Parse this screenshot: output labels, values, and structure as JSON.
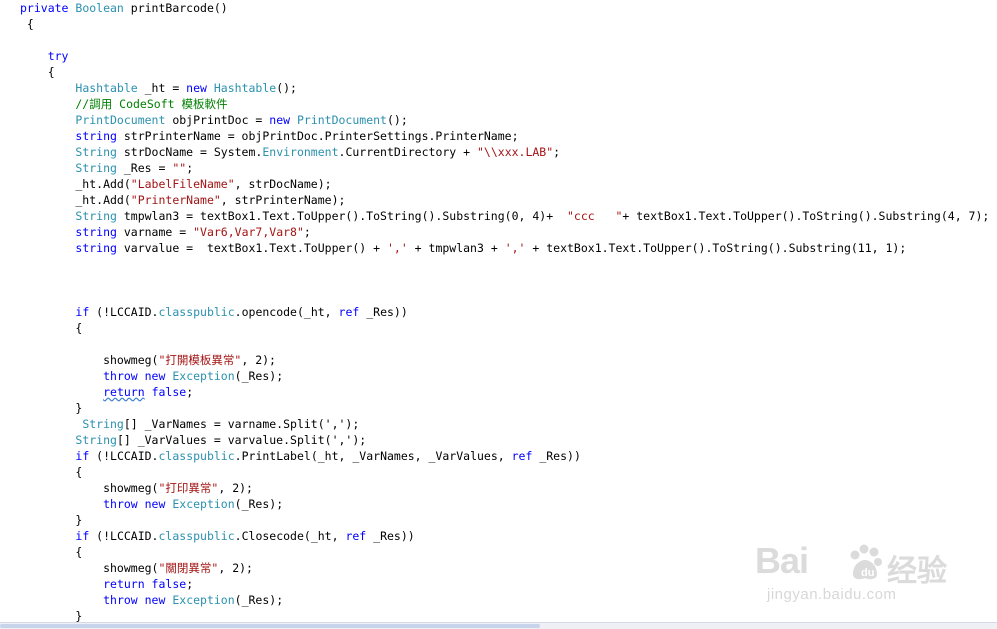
{
  "code": {
    "lines": [
      [
        {
          "t": "private ",
          "c": "kw"
        },
        {
          "t": "Boolean",
          "c": "ty"
        },
        {
          "t": " printBarcode()",
          "c": "tx"
        }
      ],
      [
        {
          "t": " {",
          "c": "tx"
        }
      ],
      [],
      [
        {
          "t": "    try",
          "c": "kw"
        }
      ],
      [
        {
          "t": "    {",
          "c": "tx"
        }
      ],
      [
        {
          "t": "        ",
          "c": "tx"
        },
        {
          "t": "Hashtable",
          "c": "ty"
        },
        {
          "t": " _ht = ",
          "c": "tx"
        },
        {
          "t": "new ",
          "c": "kw"
        },
        {
          "t": "Hashtable",
          "c": "ty"
        },
        {
          "t": "();",
          "c": "tx"
        }
      ],
      [
        {
          "t": "        //調用 CodeSoft 模板軟件",
          "c": "cm"
        }
      ],
      [
        {
          "t": "        ",
          "c": "tx"
        },
        {
          "t": "PrintDocument",
          "c": "ty"
        },
        {
          "t": " objPrintDoc = ",
          "c": "tx"
        },
        {
          "t": "new ",
          "c": "kw"
        },
        {
          "t": "PrintDocument",
          "c": "ty"
        },
        {
          "t": "();",
          "c": "tx"
        }
      ],
      [
        {
          "t": "        ",
          "c": "tx"
        },
        {
          "t": "string",
          "c": "kw"
        },
        {
          "t": " strPrinterName = objPrintDoc.PrinterSettings.PrinterName;",
          "c": "tx"
        }
      ],
      [
        {
          "t": "        ",
          "c": "tx"
        },
        {
          "t": "String",
          "c": "ty"
        },
        {
          "t": " strDocName = System.",
          "c": "tx"
        },
        {
          "t": "Environment",
          "c": "ty"
        },
        {
          "t": ".CurrentDirectory + ",
          "c": "tx"
        },
        {
          "t": "\"\\\\xxx.LAB\"",
          "c": "st"
        },
        {
          "t": ";",
          "c": "tx"
        }
      ],
      [
        {
          "t": "        ",
          "c": "tx"
        },
        {
          "t": "String",
          "c": "ty"
        },
        {
          "t": " _Res = ",
          "c": "tx"
        },
        {
          "t": "\"\"",
          "c": "st"
        },
        {
          "t": ";",
          "c": "tx"
        }
      ],
      [
        {
          "t": "        _ht.Add(",
          "c": "tx"
        },
        {
          "t": "\"LabelFileName\"",
          "c": "st"
        },
        {
          "t": ", strDocName);",
          "c": "tx"
        }
      ],
      [
        {
          "t": "        _ht.Add(",
          "c": "tx"
        },
        {
          "t": "\"PrinterName\"",
          "c": "st"
        },
        {
          "t": ", strPrinterName);",
          "c": "tx"
        }
      ],
      [
        {
          "t": "        ",
          "c": "tx"
        },
        {
          "t": "String",
          "c": "ty"
        },
        {
          "t": " tmpwlan3 = textBox1.Text.ToUpper().ToString().Substring(0, 4)+  ",
          "c": "tx"
        },
        {
          "t": "\"ccc   \"",
          "c": "st"
        },
        {
          "t": "+ textBox1.Text.ToUpper().ToString().Substring(4, 7);",
          "c": "tx"
        }
      ],
      [
        {
          "t": "        ",
          "c": "tx"
        },
        {
          "t": "string",
          "c": "kw"
        },
        {
          "t": " varname = ",
          "c": "tx"
        },
        {
          "t": "\"Var6,Var7,Var8\"",
          "c": "st"
        },
        {
          "t": ";",
          "c": "tx"
        }
      ],
      [
        {
          "t": "        ",
          "c": "tx"
        },
        {
          "t": "string",
          "c": "kw"
        },
        {
          "t": " varvalue =  textBox1.Text.ToUpper() + ",
          "c": "tx"
        },
        {
          "t": "','",
          "c": "st"
        },
        {
          "t": " + tmpwlan3 + ",
          "c": "tx"
        },
        {
          "t": "','",
          "c": "st"
        },
        {
          "t": " + textBox1.Text.ToUpper().ToString().Substring(11, 1);",
          "c": "tx"
        }
      ],
      [],
      [],
      [],
      [
        {
          "t": "        ",
          "c": "tx"
        },
        {
          "t": "if",
          "c": "kw"
        },
        {
          "t": " (!LCCAID.",
          "c": "tx"
        },
        {
          "t": "classpublic",
          "c": "ty"
        },
        {
          "t": ".opencode(_ht, ",
          "c": "tx"
        },
        {
          "t": "ref",
          "c": "kw"
        },
        {
          "t": " _Res))",
          "c": "tx"
        }
      ],
      [
        {
          "t": "        {",
          "c": "tx"
        }
      ],
      [],
      [
        {
          "t": "            showmeg(",
          "c": "tx"
        },
        {
          "t": "\"打開模板異常\"",
          "c": "st"
        },
        {
          "t": ", 2);",
          "c": "tx"
        }
      ],
      [
        {
          "t": "            ",
          "c": "tx"
        },
        {
          "t": "throw new ",
          "c": "kw"
        },
        {
          "t": "Exception",
          "c": "ty"
        },
        {
          "t": "(_Res);",
          "c": "tx"
        }
      ],
      [
        {
          "t": "            ",
          "c": "tx"
        },
        {
          "t": "return",
          "c": "kw",
          "u": true
        },
        {
          "t": " ",
          "c": "tx"
        },
        {
          "t": "false",
          "c": "kw"
        },
        {
          "t": ";",
          "c": "tx"
        }
      ],
      [
        {
          "t": "        }",
          "c": "tx"
        }
      ],
      [
        {
          "t": "         ",
          "c": "tx"
        },
        {
          "t": "String",
          "c": "ty"
        },
        {
          "t": "[] _VarNames = varname.Split(',');",
          "c": "tx"
        }
      ],
      [
        {
          "t": "        ",
          "c": "tx"
        },
        {
          "t": "String",
          "c": "ty"
        },
        {
          "t": "[] _VarValues = varvalue.Split(',');",
          "c": "tx"
        }
      ],
      [
        {
          "t": "        ",
          "c": "tx"
        },
        {
          "t": "if",
          "c": "kw"
        },
        {
          "t": " (!LCCAID.",
          "c": "tx"
        },
        {
          "t": "classpublic",
          "c": "ty"
        },
        {
          "t": ".PrintLabel(_ht, _VarNames, _VarValues, ",
          "c": "tx"
        },
        {
          "t": "ref",
          "c": "kw"
        },
        {
          "t": " _Res))",
          "c": "tx"
        }
      ],
      [
        {
          "t": "        {",
          "c": "tx"
        }
      ],
      [
        {
          "t": "            showmeg(",
          "c": "tx"
        },
        {
          "t": "\"打印異常\"",
          "c": "st"
        },
        {
          "t": ", 2);",
          "c": "tx"
        }
      ],
      [
        {
          "t": "            ",
          "c": "tx"
        },
        {
          "t": "throw new ",
          "c": "kw"
        },
        {
          "t": "Exception",
          "c": "ty"
        },
        {
          "t": "(_Res);",
          "c": "tx"
        }
      ],
      [
        {
          "t": "        }",
          "c": "tx"
        }
      ],
      [
        {
          "t": "        ",
          "c": "tx"
        },
        {
          "t": "if",
          "c": "kw"
        },
        {
          "t": " (!LCCAID.",
          "c": "tx"
        },
        {
          "t": "classpublic",
          "c": "ty"
        },
        {
          "t": ".Closecode(_ht, ",
          "c": "tx"
        },
        {
          "t": "ref",
          "c": "kw"
        },
        {
          "t": " _Res))",
          "c": "tx"
        }
      ],
      [
        {
          "t": "        {",
          "c": "tx"
        }
      ],
      [
        {
          "t": "            showmeg(",
          "c": "tx"
        },
        {
          "t": "\"關閉異常\"",
          "c": "st"
        },
        {
          "t": ", 2);",
          "c": "tx"
        }
      ],
      [
        {
          "t": "            ",
          "c": "tx"
        },
        {
          "t": "return false",
          "c": "kw"
        },
        {
          "t": ";",
          "c": "tx"
        }
      ],
      [
        {
          "t": "            ",
          "c": "tx"
        },
        {
          "t": "throw new ",
          "c": "kw"
        },
        {
          "t": "Exception",
          "c": "ty"
        },
        {
          "t": "(_Res);",
          "c": "tx"
        }
      ],
      [
        {
          "t": "        }",
          "c": "tx"
        }
      ]
    ]
  },
  "colors": {
    "keyword": "#0000ff",
    "type": "#2b91af",
    "string": "#a31515",
    "comment": "#008000",
    "text": "#000000",
    "background": "#ffffff"
  },
  "watermark": {
    "logo": "Bai",
    "paw_icon": "baidu-paw-icon",
    "brand_cn": "经验",
    "url": "jingyan.baidu.com"
  }
}
